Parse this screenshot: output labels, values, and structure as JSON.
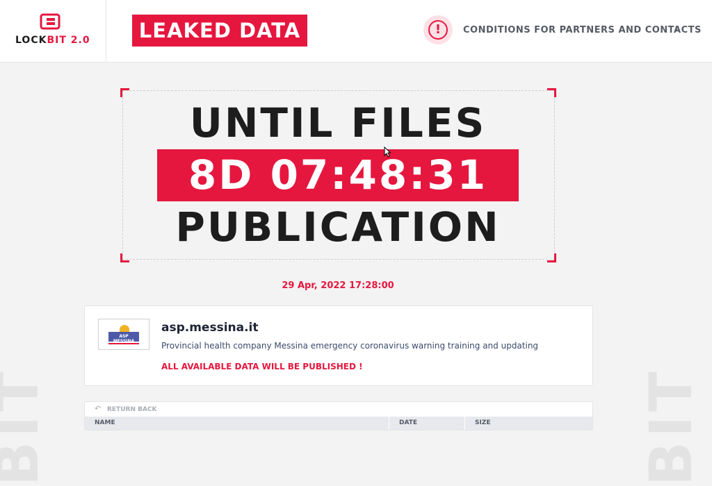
{
  "header": {
    "logo_word_a": "LOCK",
    "logo_word_b": "BIT 2.0",
    "leaked_label": "LEAKED DATA",
    "conditions_label": "CONDITIONS FOR PARTNERS AND CONTACTS",
    "conditions_chevron": "›"
  },
  "watermark": {
    "left": "BIT",
    "right": "BIT"
  },
  "countdown": {
    "top_text": "UNTIL FILES",
    "timer": "8D 07:48:31",
    "bottom_text": "PUBLICATION",
    "date": "29 Apr, 2022 17:28:00"
  },
  "company": {
    "logo_text": "ASP MESSINA",
    "domain": "asp.messina.it",
    "description": "Provincial health company Messina emergency coronavirus warning training and updating",
    "warning": "ALL AVAILABLE DATA WILL BE PUBLISHED !"
  },
  "files": {
    "return_label": "RETURN BACK",
    "columns": [
      "NAME",
      "DATE",
      "SIZE"
    ]
  },
  "colors": {
    "accent": "#e5173f",
    "text_dark": "#1d1d1d",
    "background": "#f3f3f3"
  },
  "icons": {
    "alert": "exclamation-circle-icon",
    "return": "return-arrow-icon",
    "chevron": "chevron-right-icon"
  }
}
